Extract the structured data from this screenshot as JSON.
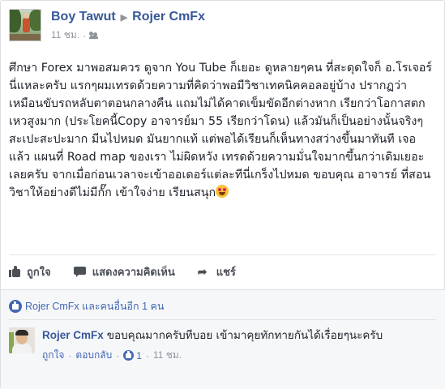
{
  "post": {
    "author": "Boy Tawut",
    "target": "Rojer CmFx",
    "time": "11 ชม.",
    "text": "ศึกษา Forex มาพอสมควร ดูจาก You Tube ก็เยอะ ดูหลายๆคน ที่สะดุดใจก็ อ.โรเจอร์นี่แหละครับ แรกๆผมเทรดด้วยความที่คิดว่าพอมีวิชาเทคนิคคอลอยู่บ้าง ปรากฏว่า เหมือนขับรถหลับตาตอนกลางคืน แถมไม่ได้คาดเข็มขัดอีกต่างหาก เรียกว่าโอกาสตกเหวสูงมาก (ประโยคนี้Copy อาจารย์มา 55 เรียกว่าโดน) แล้วมันก็เป็นอย่างนั้นจริงๆ สะเปะสะปะมาก มีนไปหมด มันยากแท้ แต่พอได้เรียนก็เห็นทางสว่างขึ้นมาทันที เจอแล้ว แผนที่ Road map ของเรา ไม่ผิดหวัง เทรดด้วยความมั่นใจมากขึ้นกว่าเดิมเยอะเลยครับ จากเมื่อก่อนเวลาจะเข้าออเดอร์แต่ละทีนี่เกร็งไปหมด ขอบคุณ อาจารย์ ที่สอนวิชาให้อย่างดีไม่มีกั๊ก เข้าใจง่าย เรียนสนุก"
  },
  "actions": {
    "like": "ถูกใจ",
    "comment": "แสดงความคิดเห็น",
    "share": "แชร์"
  },
  "reactions": {
    "summary": "Rojer CmFx และคนอื่นอีก 1 คน"
  },
  "comment": {
    "author": "Rojer CmFx",
    "text": "ขอบคุณมากครับทีบอย เข้ามาคุยทักทายกันได้เรื่อยๆนะครับ",
    "like": "ถูกใจ",
    "reply": "ตอบกลับ",
    "like_count": "1",
    "time": "11 ชม."
  },
  "colors": {
    "link": "#365899",
    "brand": "#4267b2",
    "muted": "#90949c"
  }
}
